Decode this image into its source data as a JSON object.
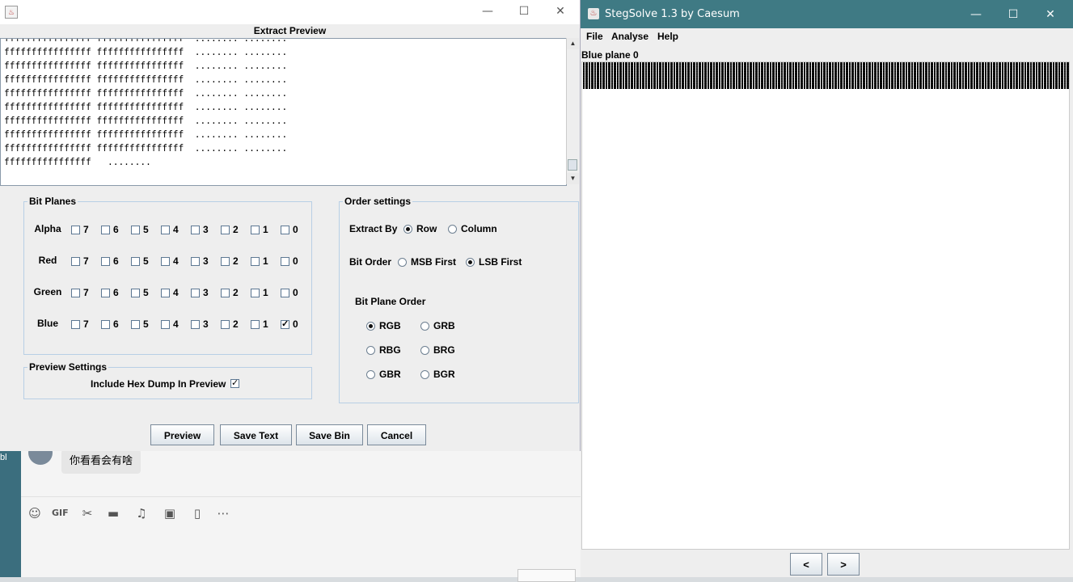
{
  "extract_window": {
    "title_icon": "java-icon",
    "label": "Extract Preview",
    "controls": {
      "minimize": "—",
      "maximize": "☐",
      "close": "✕"
    },
    "preview_text": "ffffffffffffffff ffffffffffffffff  ........ ........\nffffffffffffffff ffffffffffffffff  ........ ........\nffffffffffffffff ffffffffffffffff  ........ ........\nffffffffffffffff ffffffffffffffff  ........ ........\nffffffffffffffff ffffffffffffffff  ........ ........\nffffffffffffffff ffffffffffffffff  ........ ........\nffffffffffffffff ffffffffffffffff  ........ ........\nffffffffffffffff ffffffffffffffff  ........ ........\nffffffffffffffff ffffffffffffffff  ........ ........\nffffffffffffffff   ........",
    "bit_planes": {
      "legend": "Bit Planes",
      "rows": [
        {
          "label": "Alpha",
          "checked": []
        },
        {
          "label": "Red",
          "checked": []
        },
        {
          "label": "Green",
          "checked": []
        },
        {
          "label": "Blue",
          "checked": [
            "0"
          ]
        }
      ],
      "bits": [
        "7",
        "6",
        "5",
        "4",
        "3",
        "2",
        "1",
        "0"
      ]
    },
    "preview_settings": {
      "legend": "Preview Settings",
      "hex_dump_label": "Include Hex Dump In Preview",
      "hex_dump_checked": true
    },
    "order_settings": {
      "legend": "Order settings",
      "extract_by": {
        "label": "Extract By",
        "options": [
          "Row",
          "Column"
        ],
        "selected": "Row"
      },
      "bit_order": {
        "label": "Bit Order",
        "options": [
          "MSB First",
          "LSB First"
        ],
        "selected": "LSB First"
      },
      "bit_plane_order": {
        "label": "Bit Plane Order",
        "options": [
          "RGB",
          "GRB",
          "RBG",
          "BRG",
          "GBR",
          "BGR"
        ],
        "selected": "RGB"
      }
    },
    "buttons": {
      "preview": "Preview",
      "save_text": "Save Text",
      "save_bin": "Save Bin",
      "cancel": "Cancel"
    }
  },
  "stegsolve_window": {
    "title": "StegSolve 1.3 by Caesum",
    "controls": {
      "minimize": "—",
      "maximize": "☐",
      "close": "✕"
    },
    "menu": {
      "file": "File",
      "analyse": "Analyse",
      "help": "Help"
    },
    "plane_label": "Blue plane 0",
    "nav": {
      "prev": "<",
      "next": ">"
    }
  },
  "chat_window": {
    "message": "你看看会有啥",
    "desktop_label": "bl",
    "tools": [
      "smile-icon",
      "gif-icon",
      "scissors-icon",
      "folder-icon",
      "music-icon",
      "image-icon",
      "phone-icon",
      "more-icon"
    ],
    "tool_glyphs": {
      "smile-icon": "☺",
      "gif-icon": "GIF",
      "scissors-icon": "✂",
      "folder-icon": "▬",
      "music-icon": "♫",
      "image-icon": "▣",
      "phone-icon": "▯",
      "more-icon": "⋯"
    }
  }
}
